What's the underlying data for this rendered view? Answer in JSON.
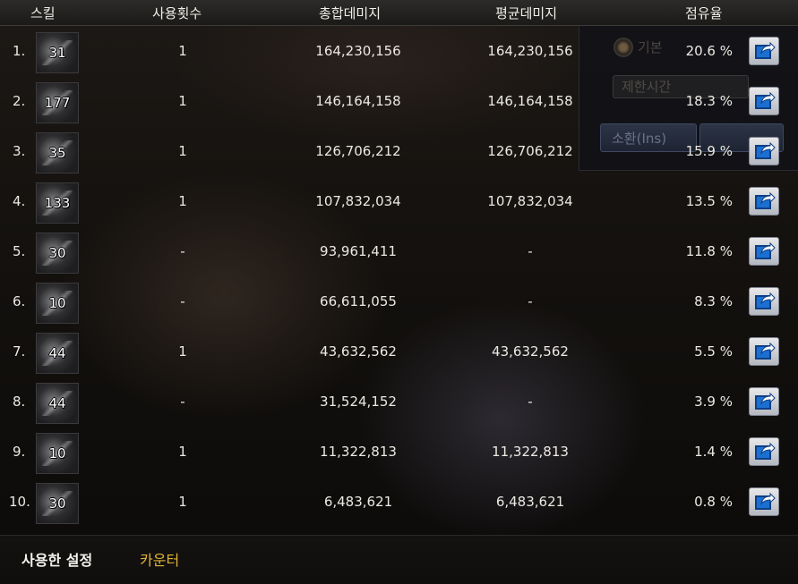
{
  "header": {
    "skill": "스킬",
    "count": "사용횟수",
    "total": "총합데미지",
    "avg": "평균데미지",
    "share": "점유율"
  },
  "background": {
    "radio_label": "기본",
    "field_text": "제한시간",
    "btn_summon": "소환(Ins)"
  },
  "rows": [
    {
      "rank": "1.",
      "level": "31",
      "count": "1",
      "total": "164,230,156",
      "avg": "164,230,156",
      "share": "20.6 %"
    },
    {
      "rank": "2.",
      "level": "177",
      "count": "1",
      "total": "146,164,158",
      "avg": "146,164,158",
      "share": "18.3 %"
    },
    {
      "rank": "3.",
      "level": "35",
      "count": "1",
      "total": "126,706,212",
      "avg": "126,706,212",
      "share": "15.9 %"
    },
    {
      "rank": "4.",
      "level": "133",
      "count": "1",
      "total": "107,832,034",
      "avg": "107,832,034",
      "share": "13.5 %"
    },
    {
      "rank": "5.",
      "level": "30",
      "count": "-",
      "total": "93,961,411",
      "avg": "-",
      "share": "11.8 %"
    },
    {
      "rank": "6.",
      "level": "10",
      "count": "-",
      "total": "66,611,055",
      "avg": "-",
      "share": "8.3 %"
    },
    {
      "rank": "7.",
      "level": "44",
      "count": "1",
      "total": "43,632,562",
      "avg": "43,632,562",
      "share": "5.5 %"
    },
    {
      "rank": "8.",
      "level": "44",
      "count": "-",
      "total": "31,524,152",
      "avg": "-",
      "share": "3.9 %"
    },
    {
      "rank": "9.",
      "level": "10",
      "count": "1",
      "total": "11,322,813",
      "avg": "11,322,813",
      "share": "1.4 %"
    },
    {
      "rank": "10.",
      "level": "30",
      "count": "1",
      "total": "6,483,621",
      "avg": "6,483,621",
      "share": "0.8 %"
    }
  ],
  "footer": {
    "tab_settings": "사용한 설정",
    "tab_counter": "카운터"
  },
  "icons": {
    "detail": "open-detail-icon",
    "skill": "skill-icon"
  },
  "colors": {
    "accent_tab": "#e0b43a",
    "detail_button": "#1b6fd0"
  }
}
